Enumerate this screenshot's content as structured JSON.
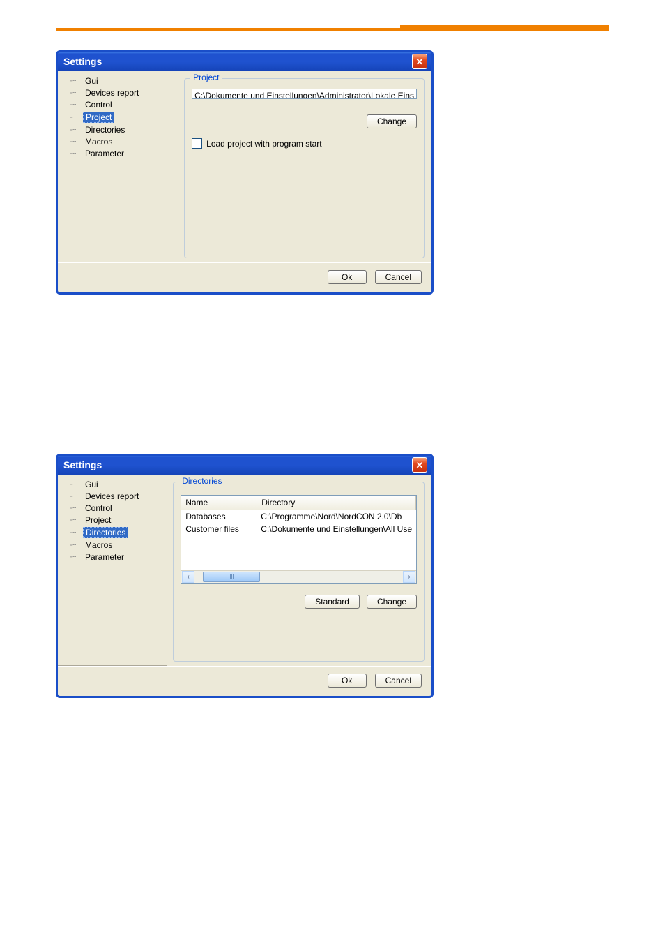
{
  "dialog1": {
    "title": "Settings",
    "tree": [
      "Gui",
      "Devices report",
      "Control",
      "Project",
      "Directories",
      "Macros",
      "Parameter"
    ],
    "tree_selected_index": 3,
    "group_label": "Project",
    "path_value": "C:\\Dokumente und Einstellungen\\Administrator\\Lokale Eins",
    "change_btn": "Change",
    "checkbox_label": "Load project with program start",
    "ok": "Ok",
    "cancel": "Cancel"
  },
  "dialog2": {
    "title": "Settings",
    "tree": [
      "Gui",
      "Devices report",
      "Control",
      "Project",
      "Directories",
      "Macros",
      "Parameter"
    ],
    "tree_selected_index": 4,
    "group_label": "Directories",
    "col_name": "Name",
    "col_dir": "Directory",
    "rows": [
      {
        "name": "Databases",
        "dir": "C:\\Programme\\Nord\\NordCON 2.0\\Db"
      },
      {
        "name": "Customer files",
        "dir": "C:\\Dokumente und Einstellungen\\All Use"
      }
    ],
    "standard_btn": "Standard",
    "change_btn": "Change",
    "ok": "Ok",
    "cancel": "Cancel"
  }
}
